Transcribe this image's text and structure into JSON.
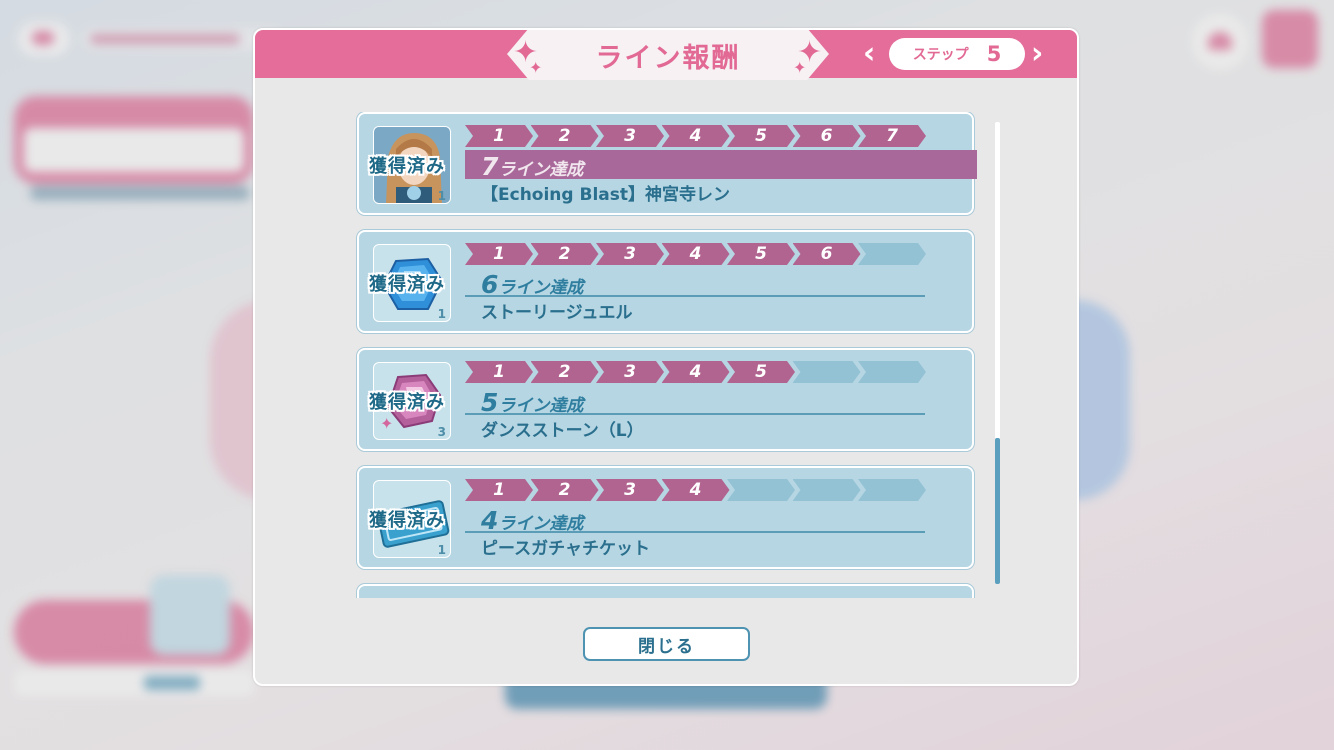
{
  "dialog": {
    "title": "ライン報酬",
    "step_label": "ステップ",
    "step_value": "5",
    "close_label": "閉じる"
  },
  "step_numbers": [
    "1",
    "2",
    "3",
    "4",
    "5",
    "6",
    "7"
  ],
  "rewards": [
    {
      "reached": 7,
      "badge": "獲得済み",
      "line_count": "7",
      "line_suffix": "ライン達成",
      "name": "【Echoing Blast】神宮寺レン",
      "count": "1",
      "icon": "character-card-icon",
      "highlight": true
    },
    {
      "reached": 6,
      "badge": "獲得済み",
      "line_count": "6",
      "line_suffix": "ライン達成",
      "name": "ストーリージュエル",
      "count": "1",
      "icon": "blue-jewel-icon",
      "highlight": false
    },
    {
      "reached": 5,
      "badge": "獲得済み",
      "line_count": "5",
      "line_suffix": "ライン達成",
      "name": "ダンスストーン（L）",
      "count": "3",
      "icon": "pink-dance-stone-icon",
      "highlight": false
    },
    {
      "reached": 4,
      "badge": "獲得済み",
      "line_count": "4",
      "line_suffix": "ライン達成",
      "name": "ピースガチャチケット",
      "count": "1",
      "icon": "gacha-ticket-icon",
      "highlight": false
    }
  ],
  "colors": {
    "header_pink": "#e46e99",
    "step_on": "#b1648f",
    "step_off": "#93c2d4",
    "card_bg": "#b6d6e3"
  }
}
